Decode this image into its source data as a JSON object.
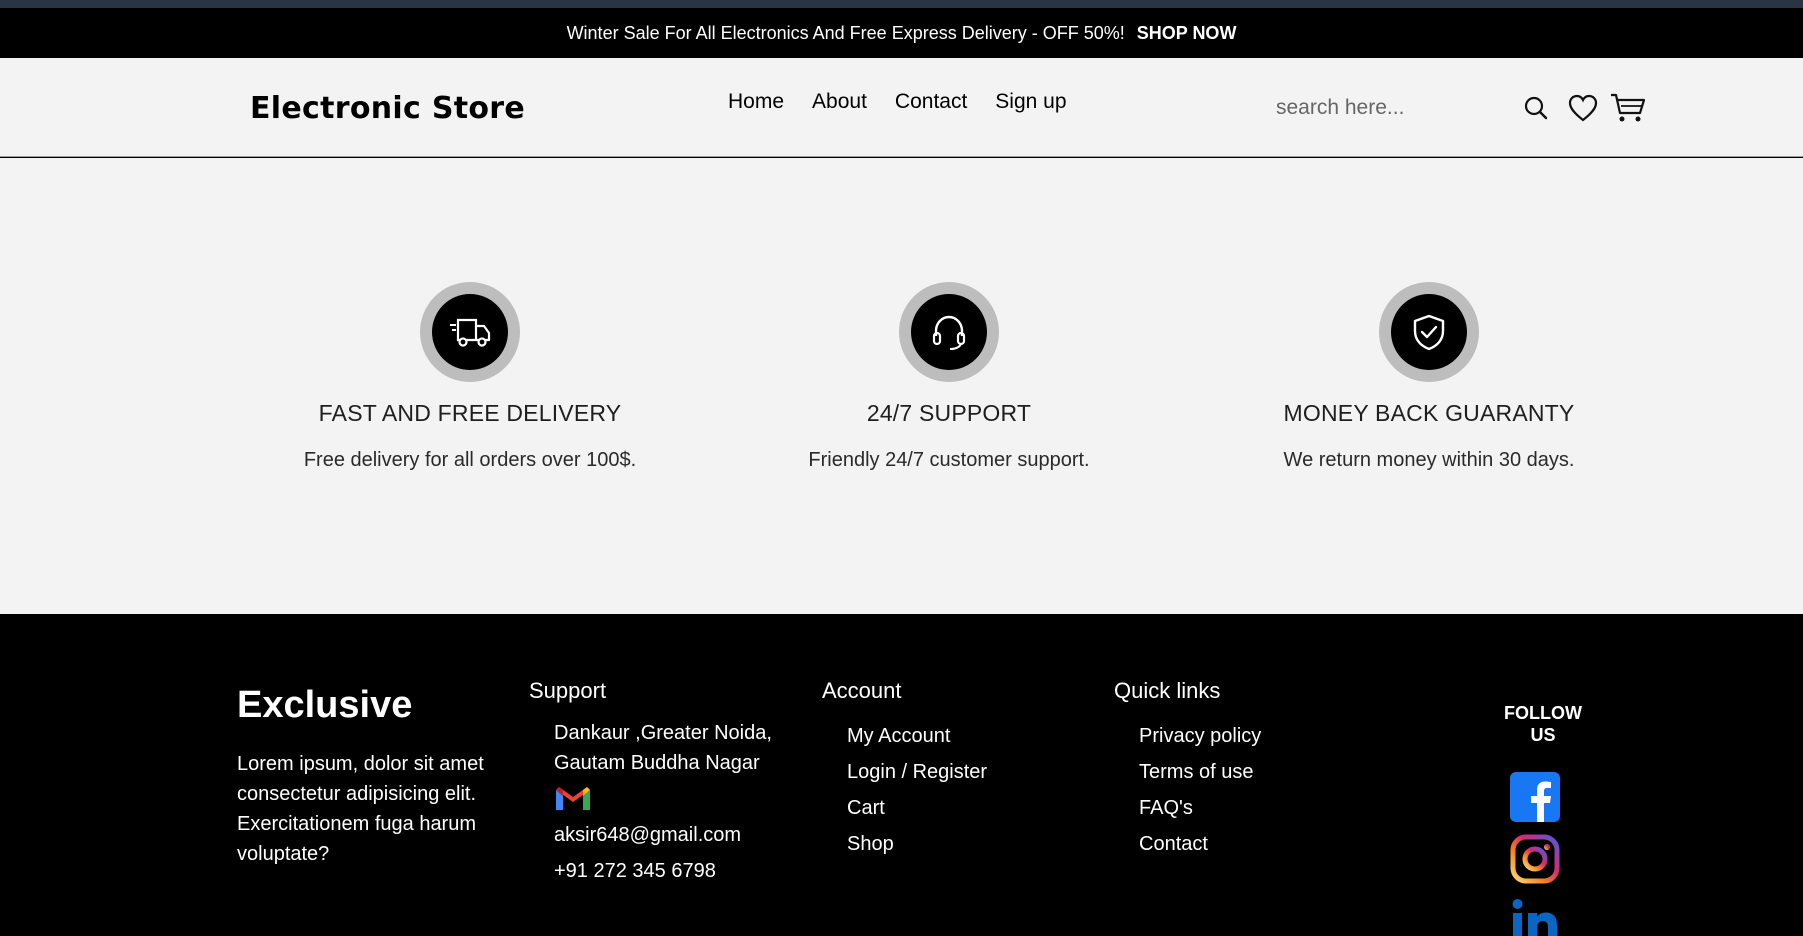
{
  "promo": {
    "text": "Winter Sale For All Electronics And Free Express Delivery - OFF 50%!",
    "cta": "SHOP NOW"
  },
  "header": {
    "brand": "Electronic Store",
    "nav": [
      "Home",
      "About",
      "Contact",
      "Sign up"
    ],
    "search_placeholder": "search here...",
    "icons": [
      "search-icon",
      "heart-icon",
      "cart-icon"
    ]
  },
  "features": [
    {
      "icon": "delivery-truck-icon",
      "title": "FAST AND FREE DELIVERY",
      "desc": "Free delivery for all orders over 100$."
    },
    {
      "icon": "headset-icon",
      "title": "24/7 SUPPORT",
      "desc": "Friendly 24/7 customer support."
    },
    {
      "icon": "shield-check-icon",
      "title": "MONEY BACK GUARANTY",
      "desc": "We return money within 30 days."
    }
  ],
  "footer": {
    "brand": "Exclusive",
    "description": "Lorem ipsum, dolor sit amet consectetur adipisicing elit. Exercitationem fuga harum voluptate?",
    "support": {
      "title": "Support",
      "address_line1": "Dankaur ,Greater Noida,",
      "address_line2": "Gautam Buddha Nagar",
      "email": "aksir648@gmail.com",
      "phone": "+91 272 345 6798"
    },
    "account": {
      "title": "Account",
      "links": [
        "My Account",
        "Login / Register",
        "Cart",
        "Shop"
      ]
    },
    "quick_links": {
      "title": "Quick links",
      "links": [
        "Privacy policy",
        "Terms of use",
        "FAQ's",
        "Contact"
      ]
    },
    "follow_line1": "FOLLOW",
    "follow_line2": "US",
    "social": [
      "facebook-icon",
      "instagram-icon",
      "linkedin-icon"
    ]
  },
  "colors": {
    "promo_bg": "#000000",
    "page_bg": "#f3f3f3",
    "footer_bg": "#000000",
    "facebook": "#1877f2",
    "linkedin": "#0a66c2"
  }
}
